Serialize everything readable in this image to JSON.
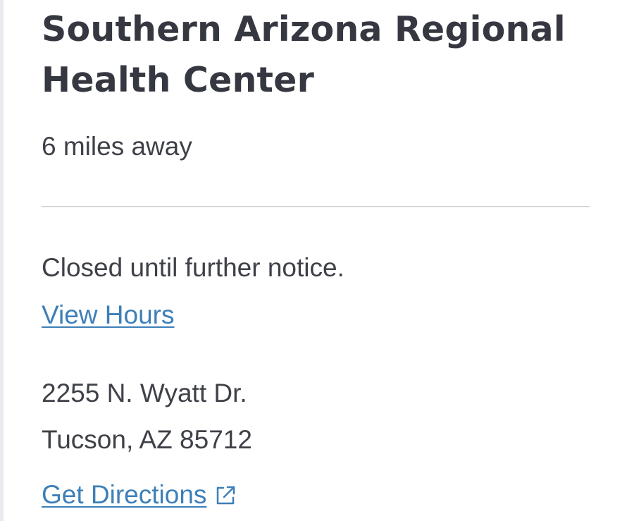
{
  "location": {
    "name": "Southern Arizona Regional Health Center",
    "distance": "6 miles away",
    "status": "Closed until further notice.",
    "view_hours_label": "View Hours",
    "address_line1": "2255 N. Wyatt Dr.",
    "address_line2": "Tucson, AZ 85712",
    "directions_label": "Get Directions",
    "directions_icon": "external-link-icon"
  },
  "colors": {
    "text": "#3f4148",
    "title": "#363841",
    "link": "#3d7fb8",
    "divider": "#d5d6da"
  }
}
